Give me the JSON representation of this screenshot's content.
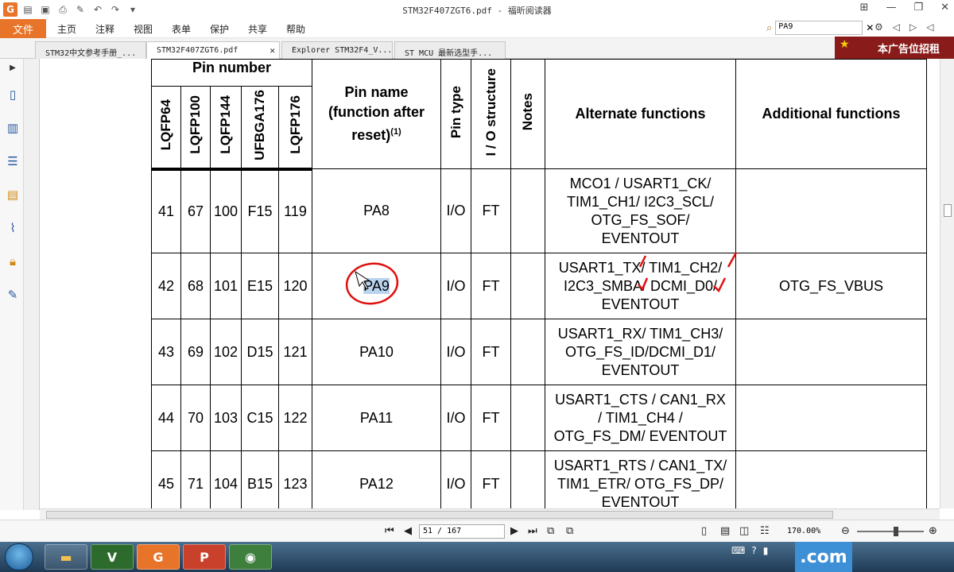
{
  "window": {
    "title": "STM32F407ZGT6.pdf - 福昕阅读器"
  },
  "menubar": {
    "file": "文件",
    "items": [
      "主页",
      "注释",
      "视图",
      "表单",
      "保护",
      "共享",
      "帮助"
    ],
    "search_value": "PA9"
  },
  "tabs": [
    {
      "label": "STM32中文参考手册_..."
    },
    {
      "label": "STM32F407ZGT6.pdf"
    },
    {
      "label": "Explorer STM32F4_V..."
    },
    {
      "label": "ST MCU 最新选型手..."
    }
  ],
  "ad": {
    "text": "本广告位招租"
  },
  "table": {
    "headers": {
      "pin_number": "Pin number",
      "packages": [
        "LQFP64",
        "LQFP100",
        "LQFP144",
        "UFBGA176",
        "LQFP176"
      ],
      "pin_name_line1": "Pin name",
      "pin_name_line2": "(function after",
      "pin_name_line3": "reset)",
      "pin_name_sup": "(1)",
      "pin_type": "Pin type",
      "io_structure": "I / O structure",
      "notes": "Notes",
      "alternate": "Alternate functions",
      "additional": "Additional functions"
    },
    "rows": [
      {
        "c1": "41",
        "c2": "67",
        "c3": "100",
        "c4": "F15",
        "c5": "119",
        "name": "PA8",
        "type": "I/O",
        "io": "FT",
        "notes": "",
        "alt": [
          "MCO1 / USART1_CK/",
          "TIM1_CH1/ I2C3_SCL/",
          "OTG_FS_SOF/",
          "EVENTOUT"
        ],
        "add": ""
      },
      {
        "c1": "42",
        "c2": "68",
        "c3": "101",
        "c4": "E15",
        "c5": "120",
        "name": "PA9",
        "type": "I/O",
        "io": "FT",
        "notes": "",
        "alt": [
          "USART1_TX/ TIM1_CH2/",
          "I2C3_SMBA/ DCMI_D0/",
          "EVENTOUT"
        ],
        "add": "OTG_FS_VBUS"
      },
      {
        "c1": "43",
        "c2": "69",
        "c3": "102",
        "c4": "D15",
        "c5": "121",
        "name": "PA10",
        "type": "I/O",
        "io": "FT",
        "notes": "",
        "alt": [
          "USART1_RX/ TIM1_CH3/",
          "OTG_FS_ID/DCMI_D1/",
          "EVENTOUT"
        ],
        "add": ""
      },
      {
        "c1": "44",
        "c2": "70",
        "c3": "103",
        "c4": "C15",
        "c5": "122",
        "name": "PA11",
        "type": "I/O",
        "io": "FT",
        "notes": "",
        "alt": [
          "USART1_CTS / CAN1_RX",
          "/ TIM1_CH4 /",
          "OTG_FS_DM/ EVENTOUT"
        ],
        "add": ""
      },
      {
        "c1": "45",
        "c2": "71",
        "c3": "104",
        "c4": "B15",
        "c5": "123",
        "name": "PA12",
        "type": "I/O",
        "io": "FT",
        "notes": "",
        "alt": [
          "USART1_RTS / CAN1_TX/",
          "TIM1_ETR/ OTG_FS_DP/",
          "EVENTOUT"
        ],
        "add": ""
      }
    ]
  },
  "navbar": {
    "page": "51 / 167",
    "zoom": "170.00%"
  },
  "taskbar": {
    "tray_text": ".com"
  }
}
